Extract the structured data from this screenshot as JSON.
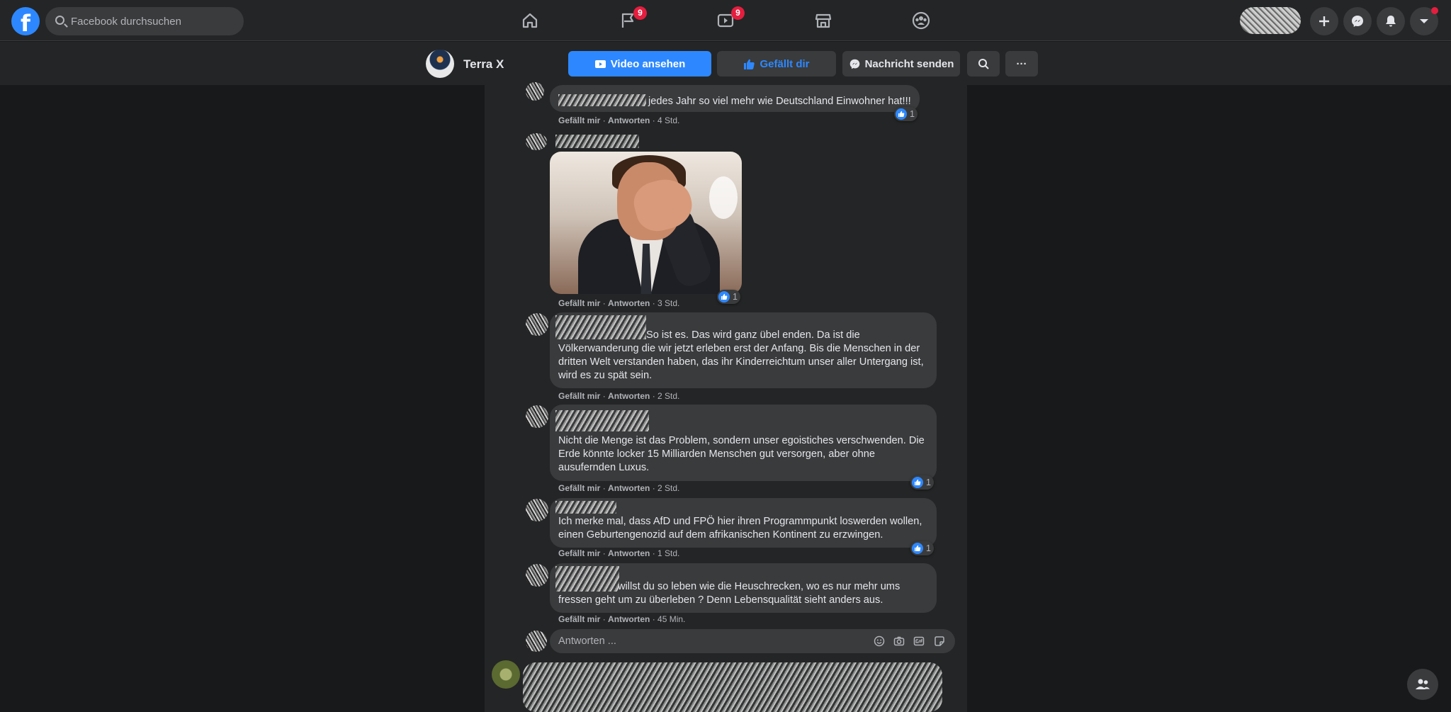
{
  "topbar": {
    "search_placeholder": "Facebook durchsuchen",
    "nav": [
      {
        "name": "home",
        "badge": ""
      },
      {
        "name": "pages",
        "badge": "9"
      },
      {
        "name": "watch",
        "badge": "9"
      },
      {
        "name": "marketplace",
        "badge": ""
      },
      {
        "name": "groups",
        "badge": ""
      }
    ],
    "colors": {
      "accent": "#2d88ff",
      "badge": "#e41e3f"
    }
  },
  "pagebar": {
    "page_name": "Terra X",
    "watch_video": "Video ansehen",
    "liked": "Gefällt dir",
    "send_message": "Nachricht senden",
    "more": "···"
  },
  "comments": [
    {
      "text": "jedes Jahr so viel mehr wie Deutschland Einwohner hat!!!",
      "like": "Gefällt mir",
      "reply": "Antworten",
      "time": "· 4 Std.",
      "reactions": "1"
    },
    {
      "text": "",
      "like": "Gefällt mir",
      "reply": "Antworten",
      "time": "· 3 Std.",
      "reactions": "1",
      "has_gif": true
    },
    {
      "text": "So ist es. Das wird ganz übel enden. Da ist die Völkerwanderung die wir jetzt erleben erst der Anfang. Bis die Menschen in der dritten Welt verstanden haben, das ihr Kinderreichtum unser aller Untergang ist, wird es zu spät sein.",
      "like": "Gefällt mir",
      "reply": "Antworten",
      "time": "· 2 Std.",
      "reactions": ""
    },
    {
      "text": "Nicht die Menge ist das Problem, sondern unser egoistiches verschwenden. Die Erde könnte locker 15 Milliarden Menschen gut versorgen, aber ohne ausufernden Luxus.",
      "like": "Gefällt mir",
      "reply": "Antworten",
      "time": "· 2 Std.",
      "reactions": "1"
    },
    {
      "text": "Ich merke mal, dass AfD und FPÖ hier ihren Programmpunkt loswerden wollen, einen Geburtengenozid auf dem afrikanischen Kontinent zu erzwingen.",
      "like": "Gefällt mir",
      "reply": "Antworten",
      "time": "· 1 Std.",
      "reactions": "1"
    },
    {
      "text": "willst du so leben wie die Heuschrecken, wo es nur mehr ums fressen geht um zu überleben ? Denn Lebensqualität sieht anders aus.",
      "like": "Gefällt mir",
      "reply": "Antworten",
      "time": "· 45 Min.",
      "reactions": ""
    }
  ],
  "reply_box": {
    "placeholder": "Antworten ..."
  }
}
